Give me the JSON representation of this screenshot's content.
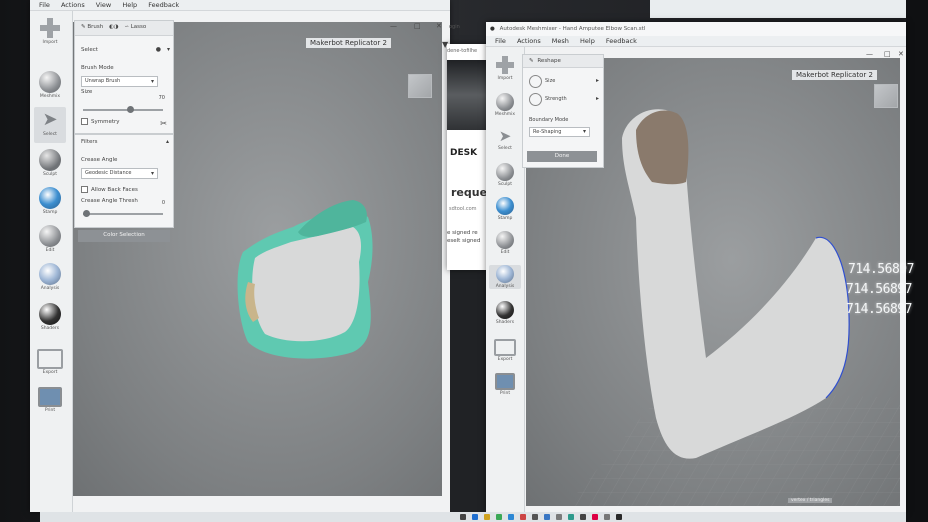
{
  "left_app": {
    "menu": [
      "File",
      "Actions",
      "View",
      "Help",
      "Feedback"
    ],
    "tools": [
      {
        "name": "Import",
        "icon": "plus-icon"
      },
      {
        "name": "Meshmix",
        "icon": "meshmix-icon"
      },
      {
        "name": "Select",
        "icon": "select-arrow-icon"
      },
      {
        "name": "Sculpt",
        "icon": "sculpt-brush-icon"
      },
      {
        "name": "Stamp",
        "icon": "stamp-icon"
      },
      {
        "name": "Edit",
        "icon": "edit-sphere-icon"
      },
      {
        "name": "Analysis",
        "icon": "analysis-sphere-icon"
      },
      {
        "name": "Shaders",
        "icon": "shaders-sphere-icon"
      },
      {
        "name": "Export",
        "icon": "export-icon"
      },
      {
        "name": "Print",
        "icon": "print-icon"
      }
    ],
    "select_panel": {
      "tab_brush": "Brush",
      "tab_lasso": "Lasso",
      "section": "Select",
      "brush_mode_label": "Brush Mode",
      "brush_mode_value": "Unwrap Brush",
      "size_label": "Size",
      "size_value": "70",
      "symmetry_label": "Symmetry"
    },
    "filters_panel": {
      "section": "Filters",
      "crease_label": "Crease Angle",
      "crease_mode_value": "Geodesic Distance",
      "allow_back_faces": "Allow Back Faces",
      "crease_angle_thresh": "Crease Angle Thresh",
      "crease_value": "0",
      "color_selection": "Color Selection"
    },
    "printer_label": "Makerbot Replicator 2"
  },
  "middle_browser": {
    "snippet_1": "ogin",
    "snippet_2": "dene-tofilhe",
    "brand": "DESK",
    "heading": "reque",
    "email": "sdtool.com",
    "line_1": "e signed re",
    "line_2": "eselt signed"
  },
  "right_app": {
    "title": "Autodesk Meshmixer - Hand Amputee Elbow Scan.stl",
    "menu": [
      "File",
      "Actions",
      "Mesh",
      "Help",
      "Feedback"
    ],
    "tools": [
      {
        "name": "Import",
        "icon": "plus-icon"
      },
      {
        "name": "Meshmix",
        "icon": "meshmix-icon"
      },
      {
        "name": "Select",
        "icon": "select-arrow-icon"
      },
      {
        "name": "Sculpt",
        "icon": "sculpt-brush-icon"
      },
      {
        "name": "Stamp",
        "icon": "stamp-icon"
      },
      {
        "name": "Edit",
        "icon": "edit-sphere-icon"
      },
      {
        "name": "Analysis",
        "icon": "analysis-sphere-icon"
      },
      {
        "name": "Shaders",
        "icon": "shaders-sphere-icon"
      },
      {
        "name": "Export",
        "icon": "export-icon"
      },
      {
        "name": "Print",
        "icon": "print-icon"
      }
    ],
    "reshape_panel": {
      "title": "Reshape",
      "size_label": "Size",
      "strength_label": "Strength",
      "smoothing_label": "Boundary Mode",
      "smoothing_value": "Re-Shaping",
      "done": "Done"
    },
    "printer_label": "Makerbot Replicator 2",
    "readouts": [
      "714.56897",
      "714.56897",
      "714.56897"
    ],
    "status": "vertex / triangles"
  },
  "colors": {
    "selection": "#5fc9b1",
    "mesh": "#d8d9d9",
    "stump": "#8a7a6c",
    "viewport": "#8a8d8f"
  }
}
